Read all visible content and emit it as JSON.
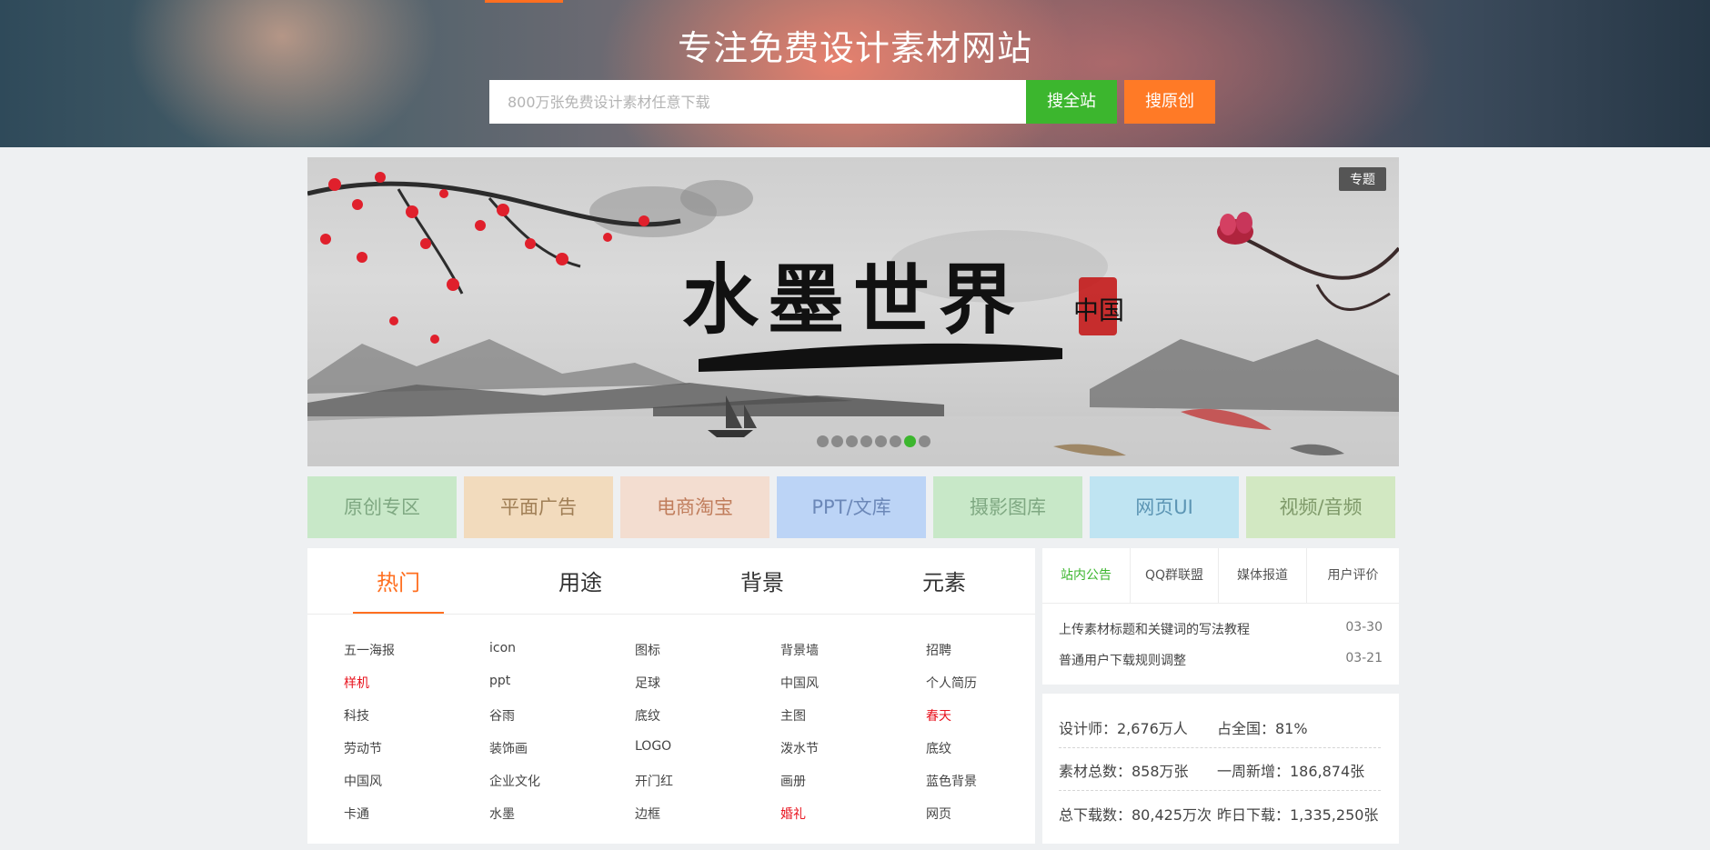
{
  "header": {
    "title": "专注免费设计素材网站",
    "search_placeholder": "800万张免费设计素材任意下载",
    "btn_search_all": "搜全站",
    "btn_search_original": "搜原创"
  },
  "banner": {
    "tag": "专题",
    "title": "水墨世界",
    "dots_count": 8,
    "active_dot": 6
  },
  "categories": [
    {
      "label": "原创专区",
      "bg": "#c8e8c8",
      "fg": "#7fa882"
    },
    {
      "label": "平面广告",
      "bg": "#f2dbbd",
      "fg": "#a07f56"
    },
    {
      "label": "电商淘宝",
      "bg": "#f3ddd0",
      "fg": "#c07d5c"
    },
    {
      "label": "PPT/文库",
      "bg": "#bcd4f6",
      "fg": "#6c88b8"
    },
    {
      "label": "摄影图库",
      "bg": "#c8e8c8",
      "fg": "#7fa882"
    },
    {
      "label": "网页UI",
      "bg": "#bfe4f2",
      "fg": "#5c95b4"
    },
    {
      "label": "视频/音频",
      "bg": "#d2e8c2",
      "fg": "#7f9a6a"
    }
  ],
  "tabs": [
    "热门",
    "用途",
    "背景",
    "元素"
  ],
  "tags": [
    [
      {
        "t": "五一海报"
      },
      {
        "t": "icon"
      },
      {
        "t": "图标"
      },
      {
        "t": "背景墙"
      },
      {
        "t": "招聘"
      }
    ],
    [
      {
        "t": "样机",
        "red": true
      },
      {
        "t": "ppt"
      },
      {
        "t": "足球"
      },
      {
        "t": "中国风"
      },
      {
        "t": "个人简历"
      }
    ],
    [
      {
        "t": "科技"
      },
      {
        "t": "谷雨"
      },
      {
        "t": "底纹"
      },
      {
        "t": "主图"
      },
      {
        "t": "春天",
        "red": true
      }
    ],
    [
      {
        "t": "劳动节"
      },
      {
        "t": "装饰画"
      },
      {
        "t": "LOGO"
      },
      {
        "t": "泼水节"
      },
      {
        "t": "底纹"
      }
    ],
    [
      {
        "t": "中国风"
      },
      {
        "t": "企业文化"
      },
      {
        "t": "开门红"
      },
      {
        "t": "画册"
      },
      {
        "t": "蓝色背景"
      }
    ],
    [
      {
        "t": "卡通"
      },
      {
        "t": "水墨"
      },
      {
        "t": "边框"
      },
      {
        "t": "婚礼",
        "red": true
      },
      {
        "t": "网页"
      }
    ]
  ],
  "notice": {
    "tabs": [
      "站内公告",
      "QQ群联盟",
      "媒体报道",
      "用户评价"
    ],
    "items": [
      {
        "title": "上传素材标题和关键词的写法教程",
        "date": "03-30"
      },
      {
        "title": "普通用户下载规则调整",
        "date": "03-21"
      }
    ]
  },
  "stats": {
    "designers": "设计师：2,676万人",
    "share": "占全国：81%",
    "total": "素材总数：858万张",
    "weekly": "一周新增：186,874张",
    "downloads": "总下载数：80,425万次",
    "yesterday": "昨日下载：1,335,250张"
  }
}
